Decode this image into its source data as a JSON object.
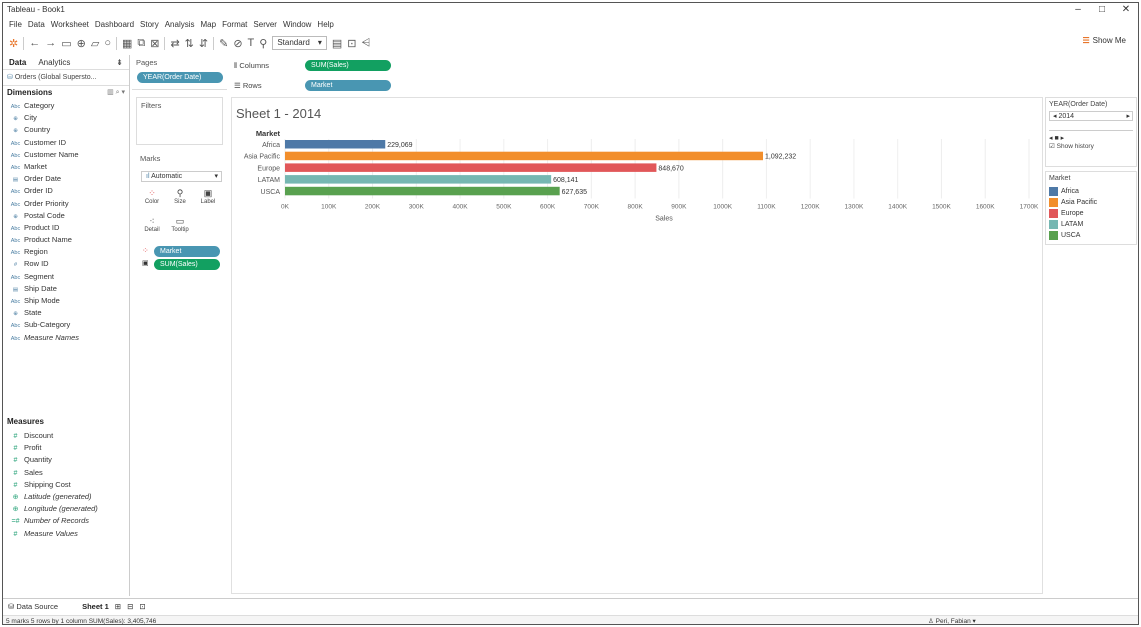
{
  "window": {
    "title": "Tableau - Book1",
    "minimize": "–",
    "maximize": "□",
    "close": "✕"
  },
  "menu": [
    "File",
    "Data",
    "Worksheet",
    "Dashboard",
    "Story",
    "Analysis",
    "Map",
    "Format",
    "Server",
    "Window",
    "Help"
  ],
  "toolbar": {
    "fit": "Standard",
    "show_me": "Show Me"
  },
  "data_pane": {
    "tab_data": "Data",
    "tab_analytics": "Analytics",
    "datasource": "Orders (Global Supersto...",
    "dimensions_label": "Dimensions",
    "dimensions": [
      {
        "type": "Abc",
        "name": "Category"
      },
      {
        "type": "globe",
        "name": "City"
      },
      {
        "type": "globe",
        "name": "Country"
      },
      {
        "type": "Abc",
        "name": "Customer ID"
      },
      {
        "type": "Abc",
        "name": "Customer Name"
      },
      {
        "type": "Abc",
        "name": "Market"
      },
      {
        "type": "date",
        "name": "Order Date"
      },
      {
        "type": "Abc",
        "name": "Order ID"
      },
      {
        "type": "Abc",
        "name": "Order Priority"
      },
      {
        "type": "globe",
        "name": "Postal Code"
      },
      {
        "type": "Abc",
        "name": "Product ID"
      },
      {
        "type": "Abc",
        "name": "Product Name"
      },
      {
        "type": "Abc",
        "name": "Region"
      },
      {
        "type": "#",
        "name": "Row ID"
      },
      {
        "type": "Abc",
        "name": "Segment"
      },
      {
        "type": "date",
        "name": "Ship Date"
      },
      {
        "type": "Abc",
        "name": "Ship Mode"
      },
      {
        "type": "globe",
        "name": "State"
      },
      {
        "type": "Abc",
        "name": "Sub-Category"
      },
      {
        "type": "Abc",
        "name": "Measure Names",
        "italic": true
      }
    ],
    "measures_label": "Measures",
    "measures": [
      {
        "type": "#",
        "name": "Discount"
      },
      {
        "type": "#",
        "name": "Profit"
      },
      {
        "type": "#",
        "name": "Quantity"
      },
      {
        "type": "#",
        "name": "Sales"
      },
      {
        "type": "#",
        "name": "Shipping Cost"
      },
      {
        "type": "globe",
        "name": "Latitude (generated)",
        "italic": true
      },
      {
        "type": "globe",
        "name": "Longitude (generated)",
        "italic": true
      },
      {
        "type": "=#",
        "name": "Number of Records",
        "italic": true
      },
      {
        "type": "#",
        "name": "Measure Values",
        "italic": true
      }
    ]
  },
  "shelves": {
    "pages_label": "Pages",
    "pages_pill": "YEAR(Order Date)",
    "filters_label": "Filters",
    "marks_label": "Marks",
    "mark_type": "Automatic",
    "mark_buttons": [
      "Color",
      "Size",
      "Label",
      "Detail",
      "Tooltip"
    ],
    "marks_pill_color": "Market",
    "marks_pill_label": "SUM(Sales)",
    "columns_label": "Columns",
    "columns_pill": "SUM(Sales)",
    "rows_label": "Rows",
    "rows_pill": "Market"
  },
  "sheet": {
    "title": "Sheet 1 - 2014"
  },
  "chart_data": {
    "type": "bar",
    "orientation": "horizontal",
    "title": "Sheet 1 - 2014",
    "row_header": "Market",
    "categories": [
      "Africa",
      "Asia Pacific",
      "Europe",
      "LATAM",
      "USCA"
    ],
    "values": [
      229069,
      1092232,
      848670,
      608141,
      627635
    ],
    "value_labels": [
      "229,069",
      "1,092,232",
      "848,670",
      "608,141",
      "627,635"
    ],
    "colors": [
      "#4e79a7",
      "#f28e2b",
      "#e15759",
      "#76b7b2",
      "#59a14f"
    ],
    "xlabel": "Sales",
    "xlim": [
      0,
      1700000
    ],
    "xticks": [
      0,
      100000,
      200000,
      300000,
      400000,
      500000,
      600000,
      700000,
      800000,
      900000,
      1000000,
      1100000,
      1200000,
      1300000,
      1400000,
      1500000,
      1600000,
      1700000
    ],
    "xtick_labels": [
      "0K",
      "100K",
      "200K",
      "300K",
      "400K",
      "500K",
      "600K",
      "700K",
      "800K",
      "900K",
      "1000K",
      "1100K",
      "1200K",
      "1300K",
      "1400K",
      "1500K",
      "1600K",
      "1700K"
    ],
    "grid": true
  },
  "page_control": {
    "title": "YEAR(Order Date)",
    "value": "2014",
    "show_history": "Show history"
  },
  "legend": {
    "title": "Market",
    "items": [
      {
        "label": "Africa",
        "color": "#4e79a7"
      },
      {
        "label": "Asia Pacific",
        "color": "#f28e2b"
      },
      {
        "label": "Europe",
        "color": "#e15759"
      },
      {
        "label": "LATAM",
        "color": "#76b7b2"
      },
      {
        "label": "USCA",
        "color": "#59a14f"
      }
    ]
  },
  "tabs": {
    "data_source": "Data Source",
    "sheet1": "Sheet 1"
  },
  "status": {
    "text": "5 marks   5 rows by 1 column   SUM(Sales): 3,405,746",
    "user": "Peri, Fabian"
  }
}
